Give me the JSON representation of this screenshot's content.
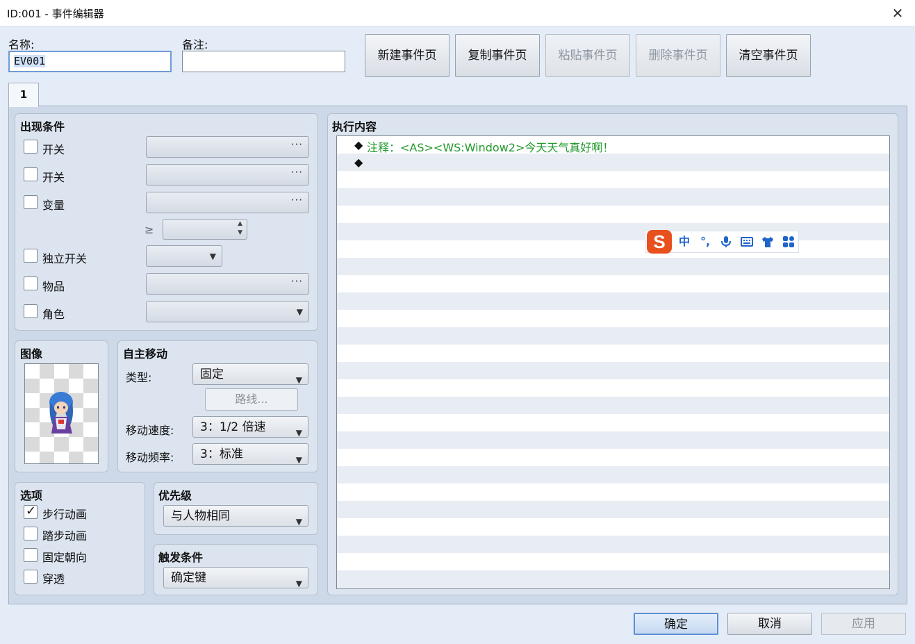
{
  "window": {
    "title": "ID:001 - 事件编辑器",
    "close_glyph": "✕"
  },
  "fields": {
    "name_label": "名称:",
    "name_value": "EV001",
    "note_label": "备注:",
    "note_value": ""
  },
  "toolbar": {
    "new_page": "新建事件页",
    "copy_page": "复制事件页",
    "paste_page": "粘贴事件页",
    "delete_page": "删除事件页",
    "clear_page": "清空事件页"
  },
  "tabs": [
    "1"
  ],
  "conditions": {
    "title": "出现条件",
    "switch1": "开关",
    "switch2": "开关",
    "variable": "变量",
    "gte": "≥",
    "self_switch": "独立开关",
    "item": "物品",
    "actor": "角色",
    "dots": "···"
  },
  "image": {
    "title": "图像"
  },
  "autonomous": {
    "title": "自主移动",
    "type_label": "类型:",
    "type_value": "固定",
    "route_button": "路线...",
    "speed_label": "移动速度:",
    "speed_value": "3：1/2 倍速",
    "freq_label": "移动频率:",
    "freq_value": "3：标准"
  },
  "options": {
    "title": "选项",
    "walking": "步行动画",
    "stepping": "踏步动画",
    "direction_fix": "固定朝向",
    "through": "穿透",
    "walking_checked": true
  },
  "priority": {
    "title": "优先级",
    "value": "与人物相同"
  },
  "trigger": {
    "title": "触发条件",
    "value": "确定键"
  },
  "contents": {
    "title": "执行内容",
    "lines": [
      {
        "bullet": "◆",
        "text": "注释：<AS><WS:Window2>今天天气真好啊！",
        "color": "#1f9a2b"
      },
      {
        "bullet": "◆",
        "text": ""
      }
    ]
  },
  "ime_toolbar": {
    "logo": "S",
    "lang": "中",
    "punct": "°,",
    "icons": [
      "microphone-icon",
      "keyboard-icon",
      "shirt-icon",
      "apps-icon"
    ]
  },
  "buttons": {
    "ok": "确定",
    "cancel": "取消",
    "apply": "应用"
  }
}
